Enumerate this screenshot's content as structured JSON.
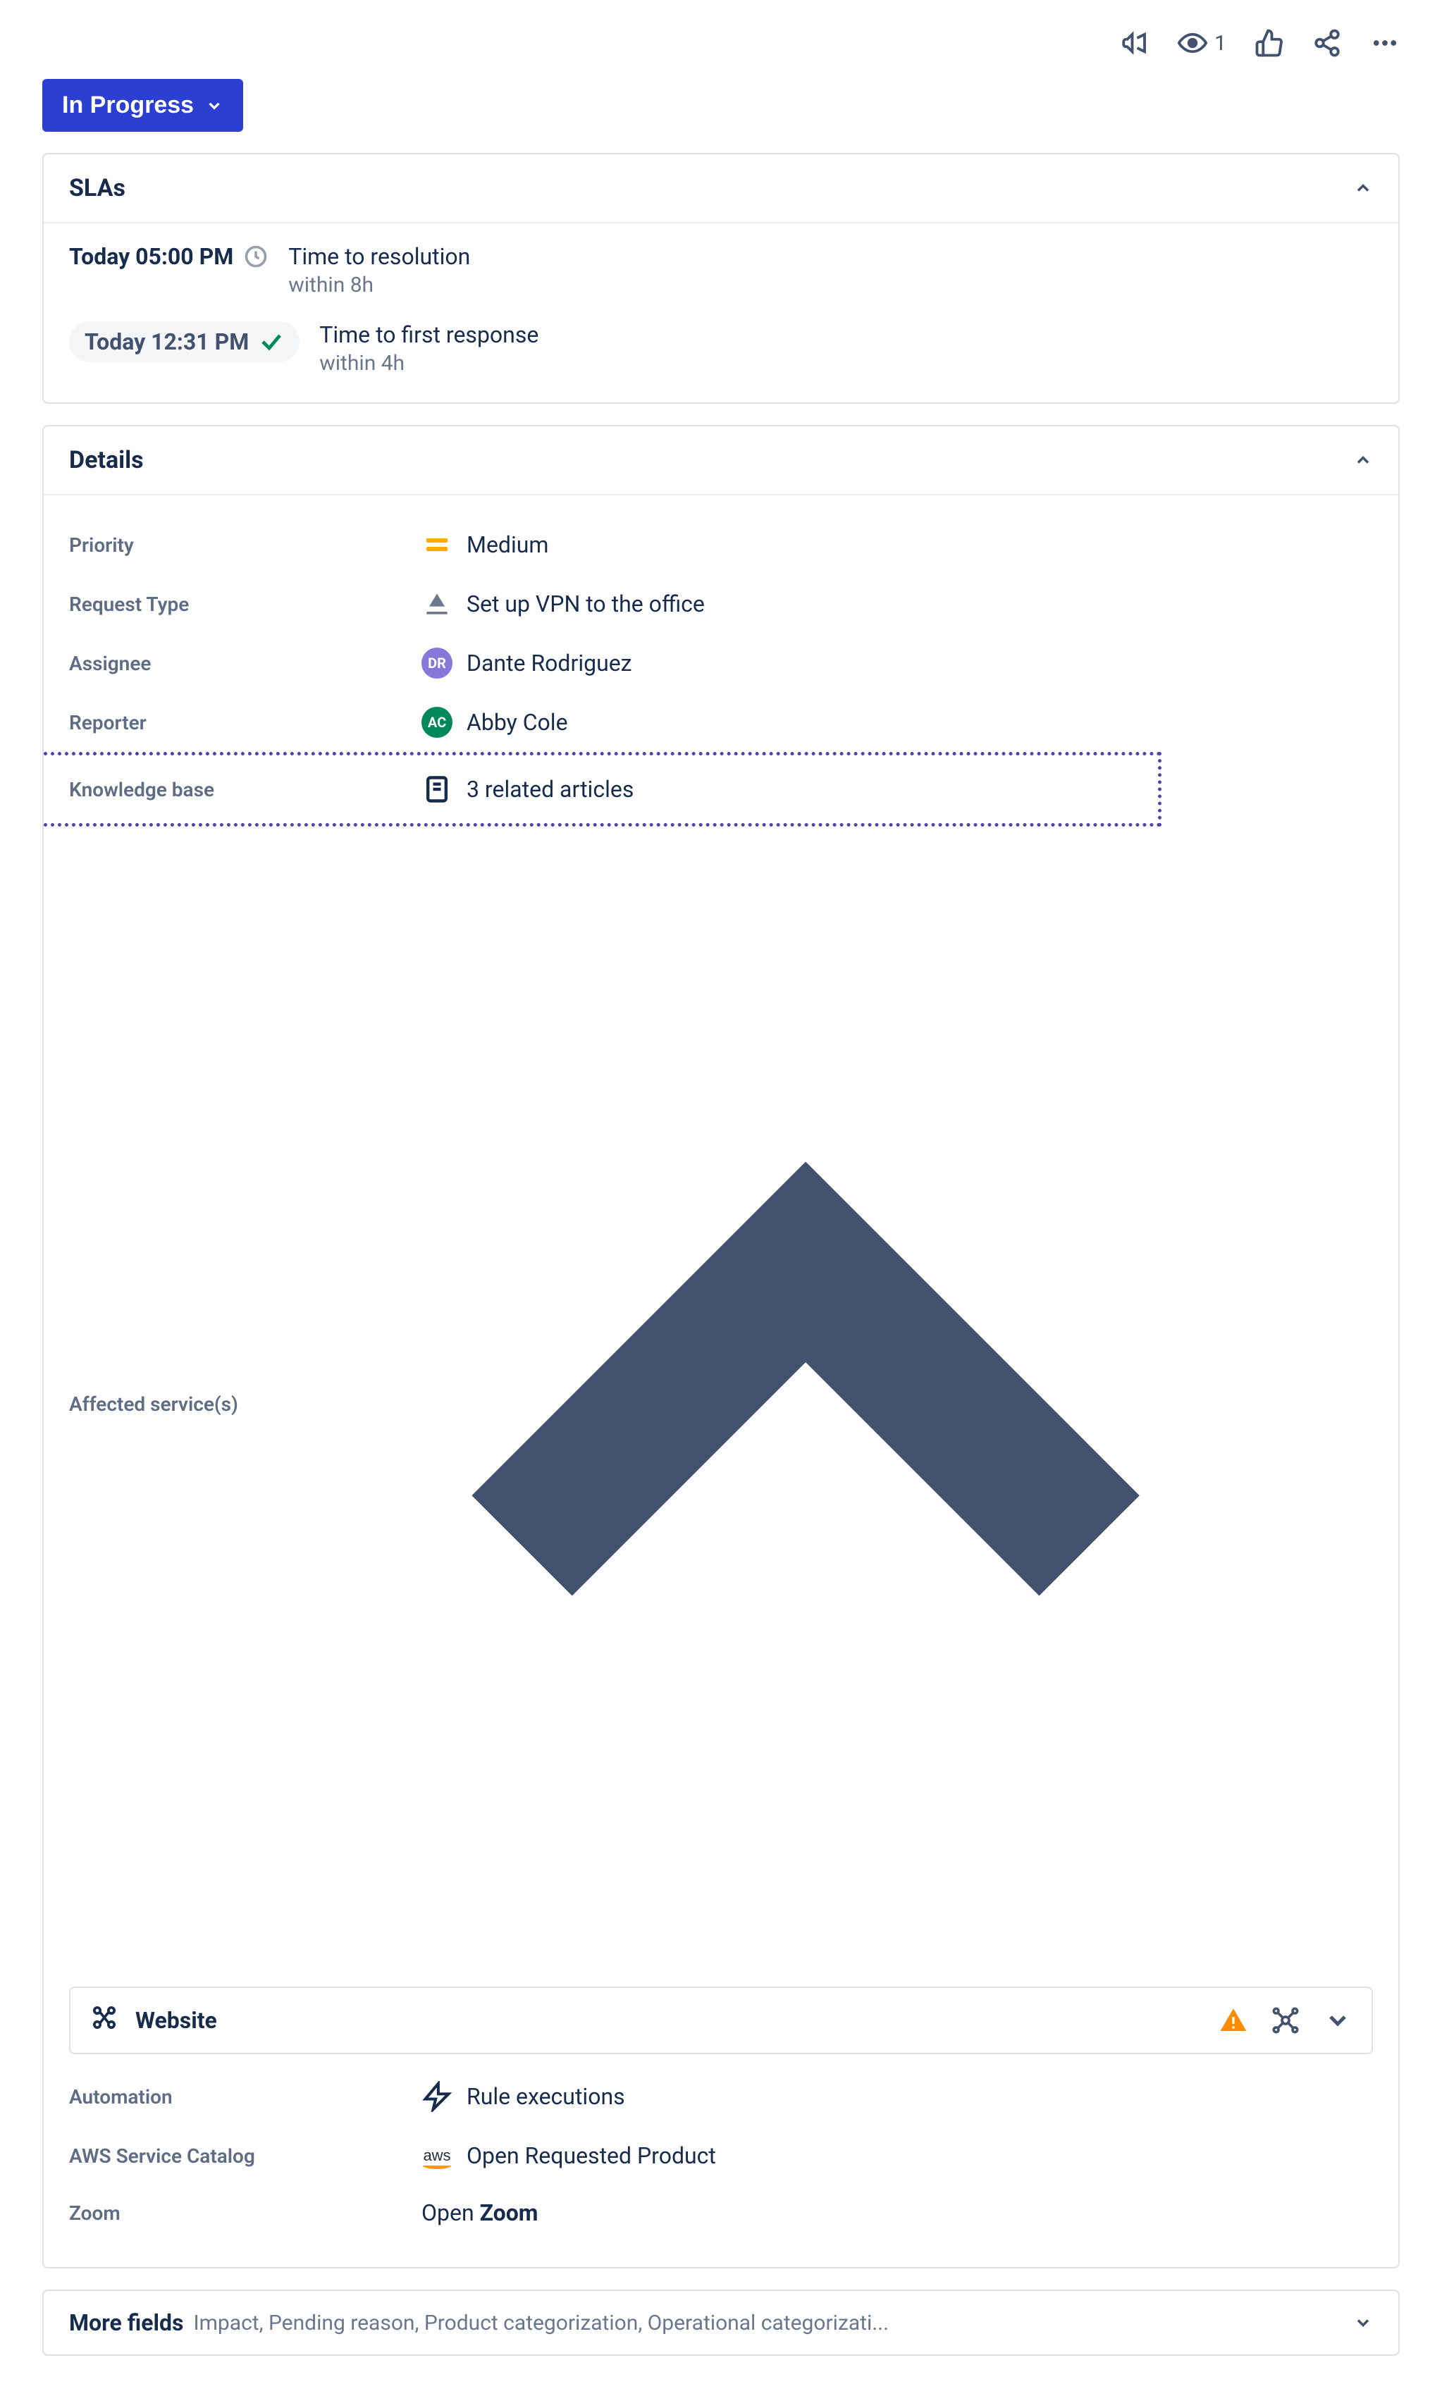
{
  "toolbar": {
    "watch_count": "1"
  },
  "status": {
    "label": "In Progress"
  },
  "slas": {
    "title": "SLAs",
    "items": [
      {
        "time": "Today 05:00 PM",
        "state": "pending",
        "name": "Time to resolution",
        "threshold": "within 8h"
      },
      {
        "time": "Today 12:31 PM",
        "state": "met",
        "name": "Time to first response",
        "threshold": "within 4h"
      }
    ]
  },
  "details": {
    "title": "Details",
    "priority": {
      "label": "Priority",
      "value": "Medium"
    },
    "request_type": {
      "label": "Request Type",
      "value": "Set up VPN to the office"
    },
    "assignee": {
      "label": "Assignee",
      "value": "Dante Rodriguez"
    },
    "reporter": {
      "label": "Reporter",
      "value": "Abby Cole"
    },
    "knowledge_base": {
      "label": "Knowledge base",
      "value": "3 related articles"
    },
    "affected_services": {
      "label": "Affected service(s)",
      "service": "Website"
    },
    "automation": {
      "label": "Automation",
      "value": "Rule executions"
    },
    "aws_catalog": {
      "label": "AWS Service Catalog",
      "value": "Open Requested Product",
      "icon_text": "aws"
    },
    "zoom": {
      "label": "Zoom",
      "value_prefix": "Open ",
      "value_strong": "Zoom"
    }
  },
  "more_fields": {
    "label": "More fields",
    "desc": "Impact, Pending reason, Product categorization, Operational categorizati..."
  }
}
